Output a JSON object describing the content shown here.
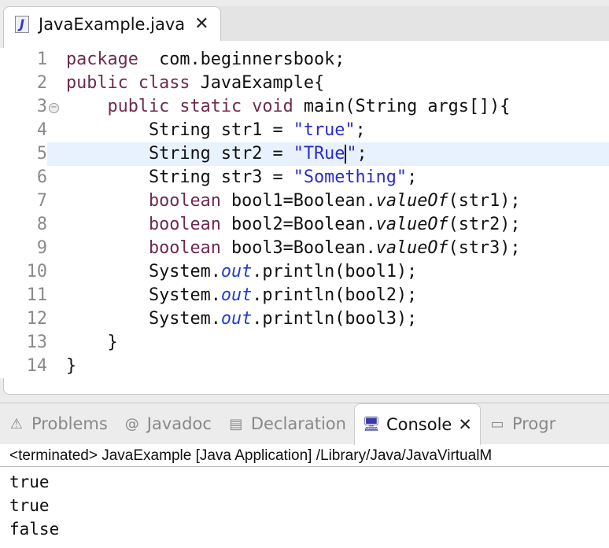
{
  "editor": {
    "tab_label": "JavaExample.java",
    "lines": [
      [
        [
          "kw",
          "package"
        ],
        [
          "",
          "  com.beginnersbook;"
        ]
      ],
      [
        [
          "kw",
          "public"
        ],
        [
          "",
          " "
        ],
        [
          "kw",
          "class"
        ],
        [
          "",
          " JavaExample{"
        ]
      ],
      [
        [
          "",
          "    "
        ],
        [
          "kw",
          "public"
        ],
        [
          "",
          " "
        ],
        [
          "kw",
          "static"
        ],
        [
          "",
          " "
        ],
        [
          "kw",
          "void"
        ],
        [
          "",
          " main(String args[]){"
        ]
      ],
      [
        [
          "",
          "        String str1 = "
        ],
        [
          "str",
          "\"true\""
        ],
        [
          "",
          ";"
        ]
      ],
      [
        [
          "",
          "        String str2 = "
        ],
        [
          "str",
          "\"TRue"
        ],
        [
          "caret",
          ""
        ],
        [
          "str",
          "\""
        ],
        [
          "",
          ";"
        ]
      ],
      [
        [
          "",
          "        String str3 = "
        ],
        [
          "str",
          "\"Something\""
        ],
        [
          "",
          ";"
        ]
      ],
      [
        [
          "",
          "        "
        ],
        [
          "kw",
          "boolean"
        ],
        [
          "",
          " bool1=Boolean."
        ],
        [
          "it",
          "valueOf"
        ],
        [
          "",
          "(str1);"
        ]
      ],
      [
        [
          "",
          "        "
        ],
        [
          "kw",
          "boolean"
        ],
        [
          "",
          " bool2=Boolean."
        ],
        [
          "it",
          "valueOf"
        ],
        [
          "",
          "(str2);"
        ]
      ],
      [
        [
          "",
          "        "
        ],
        [
          "kw",
          "boolean"
        ],
        [
          "",
          " bool3=Boolean."
        ],
        [
          "it",
          "valueOf"
        ],
        [
          "",
          "(str3);"
        ]
      ],
      [
        [
          "",
          "        System."
        ],
        [
          "fld",
          "out"
        ],
        [
          "",
          ".println(bool1);"
        ]
      ],
      [
        [
          "",
          "        System."
        ],
        [
          "fld",
          "out"
        ],
        [
          "",
          ".println(bool2);"
        ]
      ],
      [
        [
          "",
          "        System."
        ],
        [
          "fld",
          "out"
        ],
        [
          "",
          ".println(bool3);"
        ]
      ],
      [
        [
          "",
          "    }"
        ]
      ],
      [
        [
          "",
          "}"
        ]
      ]
    ]
  },
  "bottom": {
    "tabs": [
      {
        "label": "Problems",
        "icon": "problems-icon"
      },
      {
        "label": "Javadoc",
        "icon": "@"
      },
      {
        "label": "Declaration",
        "icon": "declaration-icon"
      },
      {
        "label": "Console",
        "icon": "console-icon"
      },
      {
        "label": "Progr",
        "icon": "progress-icon"
      }
    ],
    "console_header": "<terminated> JavaExample [Java Application] /Library/Java/JavaVirtualM",
    "output": [
      "true",
      "true",
      "false"
    ]
  }
}
